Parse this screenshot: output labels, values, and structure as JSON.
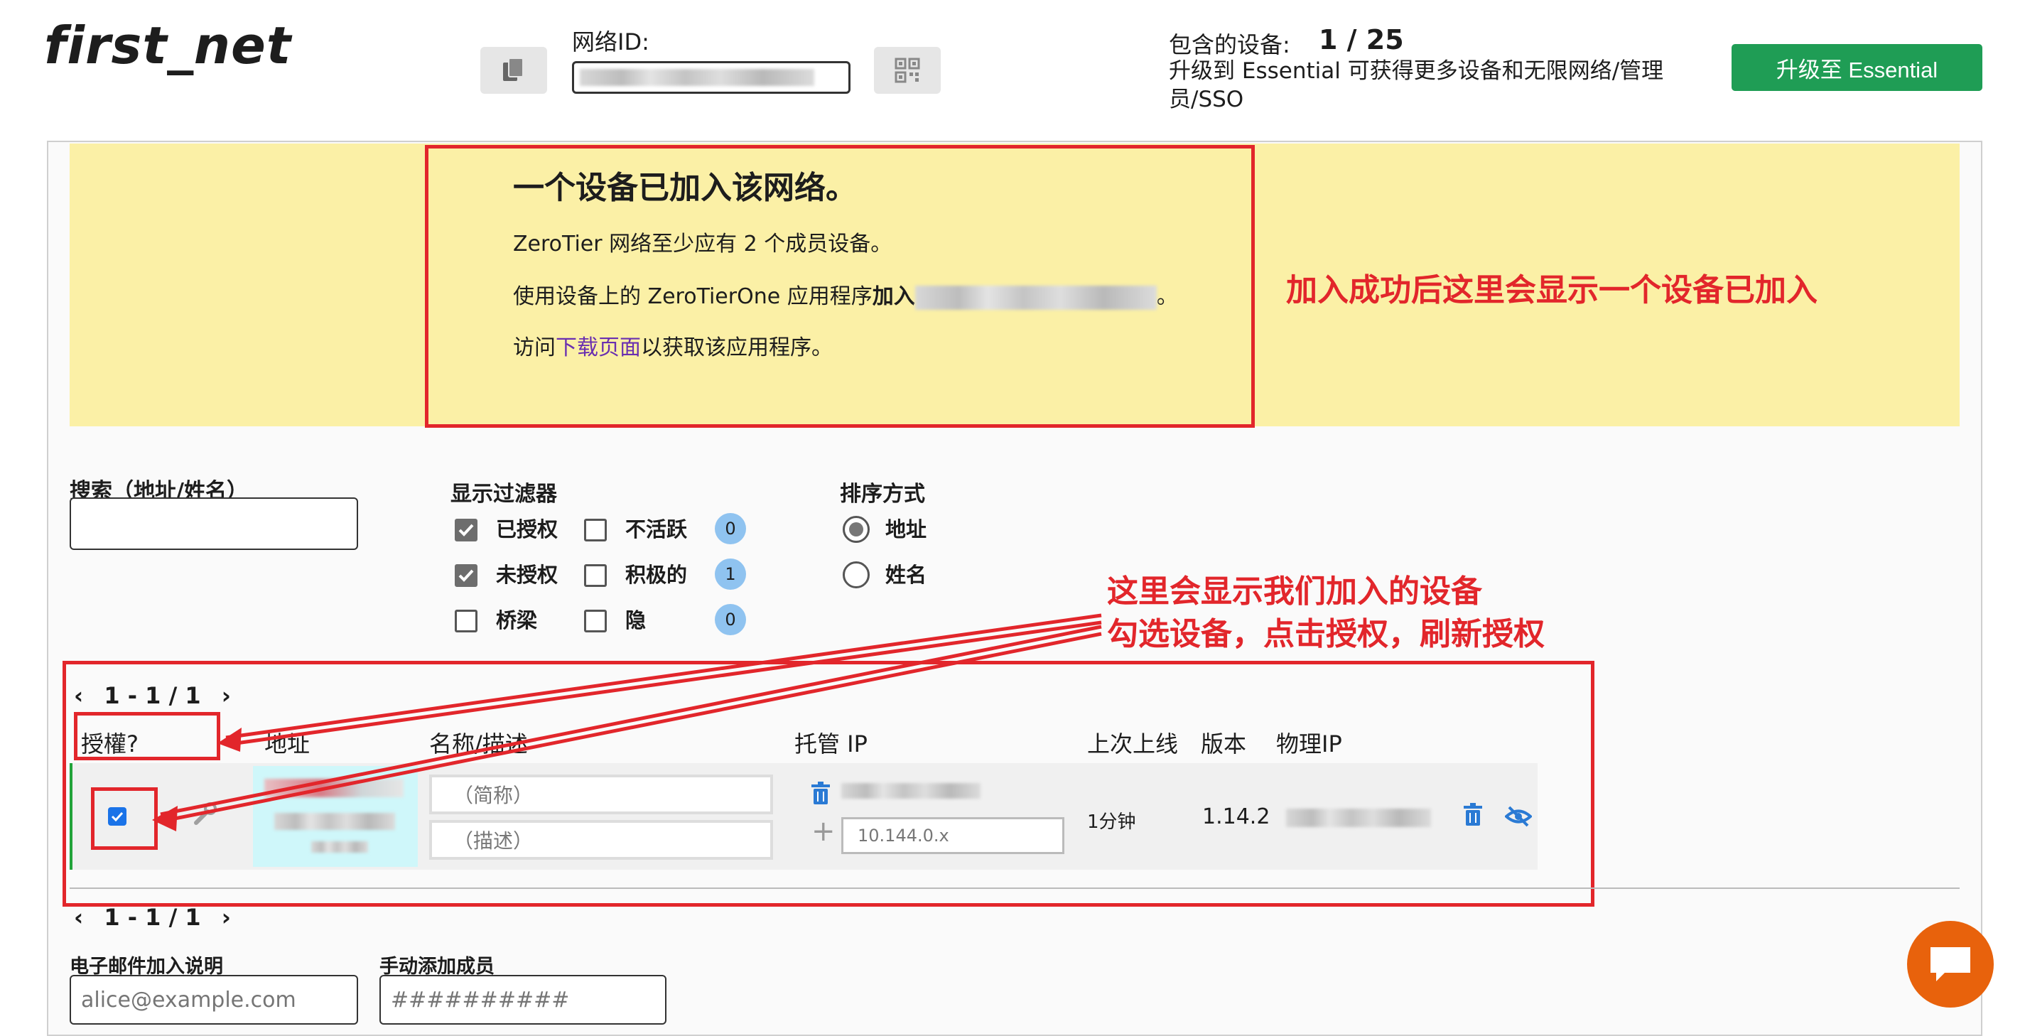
{
  "header": {
    "network_name": "first_net",
    "network_id_label": "网络ID:",
    "devices_label": "包含的设备:",
    "devices_count": "1 / 25",
    "upgrade_text": "升级到 Essential 可获得更多设备和无限网络/管理员/SSO",
    "upgrade_button": "升级至 Essential"
  },
  "banner": {
    "title": "一个设备已加入该网络。",
    "line1": "ZeroTier 网络至少应有 2 个成员设备。",
    "line2_prefix": "使用设备上的 ZeroTierOne 应用程序",
    "line2_join": "加入",
    "line2_suffix": "。",
    "line3_prefix": "访问",
    "line3_link": "下载页面",
    "line3_suffix": "以获取该应用程序。"
  },
  "annotations": {
    "note1": "加入成功后这里会显示一个设备已加入",
    "note2_line1": "这里会显示我们加入的设备",
    "note2_line2": "勾选设备，点击授权，刷新授权"
  },
  "search": {
    "label": "搜索（地址/姓名）",
    "value": ""
  },
  "filters": {
    "label": "显示过滤器",
    "items": [
      {
        "label": "已授权",
        "checked": true
      },
      {
        "label": "未授权",
        "checked": true
      },
      {
        "label": "桥梁",
        "checked": false
      },
      {
        "label": "不活跃",
        "checked": false,
        "count": "0"
      },
      {
        "label": "积极的",
        "checked": false,
        "count": "1"
      },
      {
        "label": "隐",
        "checked": false,
        "count": "0"
      }
    ]
  },
  "sort": {
    "label": "排序方式",
    "options": [
      {
        "label": "地址",
        "selected": true
      },
      {
        "label": "姓名",
        "selected": false
      }
    ]
  },
  "pager": {
    "top": "1 - 1  /  1",
    "bottom": "1 - 1  /  1"
  },
  "table": {
    "headers": {
      "auth": "授權?",
      "address": "地址",
      "name": "名称/描述",
      "managed_ip": "托管 IP",
      "last_seen": "上次上线",
      "version": "版本",
      "physical_ip": "物理IP"
    },
    "rows": [
      {
        "authorized": true,
        "name_placeholder": "（简称）",
        "desc_placeholder": "（描述）",
        "ip_placeholder": "10.144.0.x",
        "last_seen": "1分钟",
        "version": "1.14.2"
      }
    ]
  },
  "footer": {
    "email_label": "电子邮件加入说明",
    "email_placeholder": "alice@example.com",
    "manual_label": "手动添加成员",
    "manual_placeholder": "##########"
  },
  "colors": {
    "accent_green": "#1f9d55",
    "banner_yellow": "#fbf0a6",
    "annotation_red": "#e2262b",
    "chat_orange": "#e8620c"
  }
}
